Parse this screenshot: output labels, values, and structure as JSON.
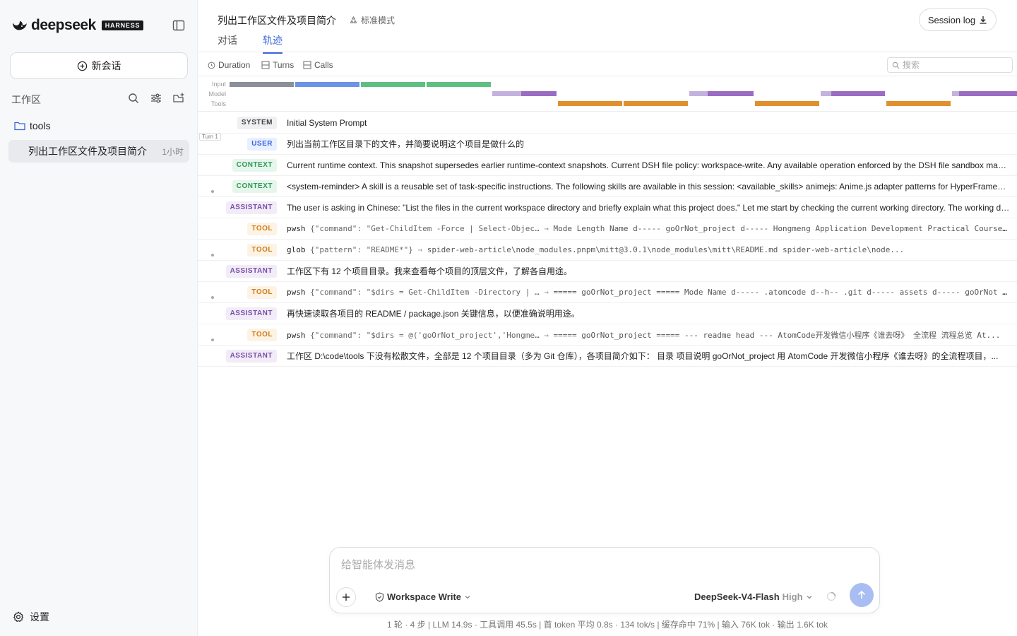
{
  "sidebar": {
    "brand_text": "deepseek",
    "brand_badge": "HARNESS",
    "new_chat_label": "新会话",
    "workspace_label": "工作区",
    "folder_name": "tools",
    "session": {
      "title": "列出工作区文件及项目简介",
      "time": "1小时"
    },
    "settings_label": "设置"
  },
  "header": {
    "title": "列出工作区文件及项目简介",
    "mode": "标准模式",
    "session_log_label": "Session log",
    "tabs": [
      {
        "label": "对话",
        "active": false
      },
      {
        "label": "轨迹",
        "active": true
      }
    ]
  },
  "toolbar": {
    "duration_label": "Duration",
    "turns_label": "Turns",
    "calls_label": "Calls",
    "search_placeholder": "搜索"
  },
  "timeline": {
    "labels": [
      "Input",
      "Model",
      "Tools"
    ],
    "colors": {
      "input_system": "#8a8f99",
      "input_user": "#6b93e6",
      "input_context": "#5fbf83",
      "model_prefill": "#c4b2de",
      "model_gen": "#9b6cc4",
      "tools": "#e0902f"
    }
  },
  "trace": {
    "turn_tag": "Turn 1",
    "rows": [
      {
        "kind": "system",
        "badge": "SYSTEM",
        "text": "Initial System Prompt"
      },
      {
        "kind": "user",
        "badge": "USER",
        "text": "列出当前工作区目录下的文件，并简要说明这个项目是做什么的"
      },
      {
        "kind": "context",
        "badge": "CONTEXT",
        "text": "Current runtime context. This snapshot supersedes earlier runtime-context snapshots. Current DSH file policy: workspace-write. Any available operation enforced by the DSH file sandbox may be used within the workspace."
      },
      {
        "kind": "context",
        "badge": "CONTEXT",
        "text": "<system-reminder> A skill is a reusable set of task-specific instructions. The following skills are available in this session: <available_skills> animejs: Anime.js adapter patterns for HyperFrames. Use when..."
      },
      {
        "kind": "assistant",
        "badge": "ASSISTANT",
        "text": "The user is asking in Chinese: \"List the files in the current workspace directory and briefly explain what this project does.\" Let me start by checking the current working directory. The working directory is..."
      },
      {
        "kind": "tool",
        "badge": "TOOL",
        "name": "pwsh",
        "args": "{\"command\": \"Get-ChildItem -Force | Select-Objec…",
        "out": "Mode Length Name d----- goOrNot_project d----- Hongmeng Application Development Practical Course..."
      },
      {
        "kind": "tool",
        "badge": "TOOL",
        "name": "glob",
        "args": "{\"pattern\": \"README*\"}",
        "out": "spider-web-article\\node_modules.pnpm\\mitt@3.0.1\\node_modules\\mitt\\README.md spider-web-article\\node..."
      },
      {
        "kind": "assistant",
        "badge": "ASSISTANT",
        "text": "工作区下有 12 个项目目录。我来查看每个项目的顶层文件，了解各自用途。"
      },
      {
        "kind": "tool",
        "badge": "TOOL",
        "name": "pwsh",
        "args": "{\"command\": \"$dirs = Get-ChildItem -Directory | …",
        "out": "===== goOrNot_project ===== Mode Name d----- .atomcode d--h-- .git d----- assets d----- goOrNot ..."
      },
      {
        "kind": "assistant",
        "badge": "ASSISTANT",
        "text": "再快速读取各项目的 README / package.json 关键信息，以便准确说明用途。"
      },
      {
        "kind": "tool",
        "badge": "TOOL",
        "name": "pwsh",
        "args": "{\"command\": \"$dirs = @('goOrNot_project','Hongme…",
        "out": "===== goOrNot_project ===== --- readme head --- AtomCode开发微信小程序《谁去呀》 全流程 流程总览 At..."
      },
      {
        "kind": "assistant",
        "badge": "ASSISTANT",
        "text": "工作区 D:\\code\\tools 下没有松散文件，全部是 12 个项目目录（多为 Git 仓库），各项目简介如下： 目录 项目说明 goOrNot_project 用 AtomCode 开发微信小程序《谁去呀》的全流程项目，..."
      }
    ]
  },
  "composer": {
    "placeholder": "给智能体发消息",
    "workspace_mode": "Workspace Write",
    "model": "DeepSeek-V4-Flash",
    "effort": "High"
  },
  "status": {
    "text": "1 轮 · 4 步  |  LLM 14.9s · 工具调用 45.5s  |  首 token 平均 0.8s · 134 tok/s  |  缓存命中 71%  |  输入 76K tok · 输出 1.6K tok"
  }
}
